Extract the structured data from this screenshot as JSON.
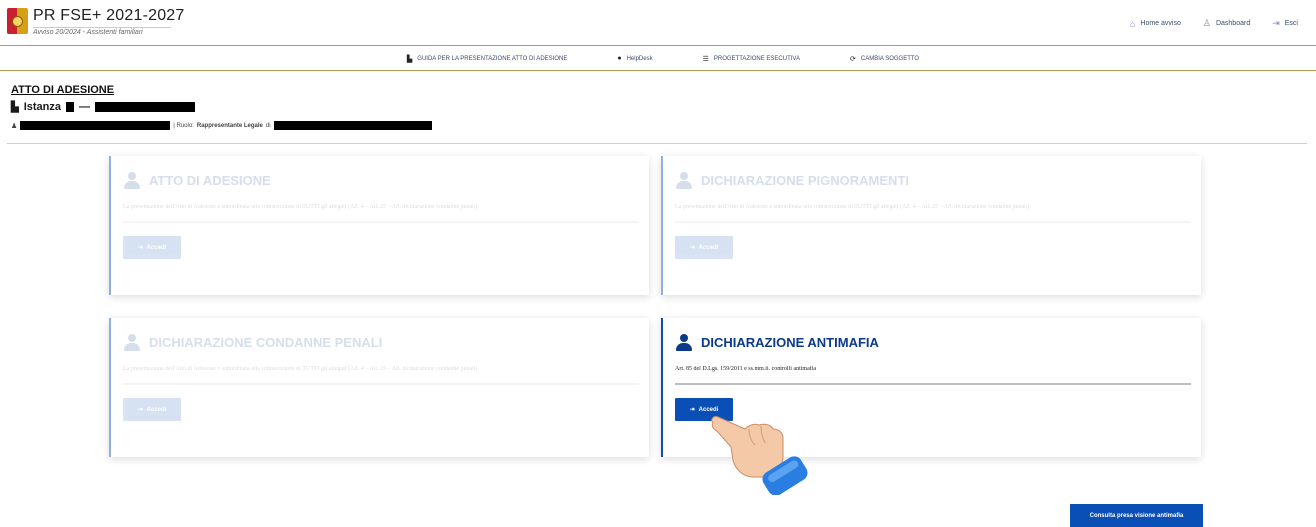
{
  "header": {
    "title": "PR FSE+ 2021-2027",
    "subtitle": "Avviso 20/2024 - Assistenti familiari",
    "nav": [
      {
        "label": "Home avviso",
        "icon": "home-icon"
      },
      {
        "label": "Dashboard",
        "icon": "user-icon"
      },
      {
        "label": "Esci",
        "icon": "logout-icon"
      }
    ]
  },
  "subnav": [
    {
      "label": "GUIDA PER LA PRESENTAZIONE ATTO DI ADESIONE",
      "icon": "file-icon"
    },
    {
      "label": "HelpDesk",
      "icon": "help-icon"
    },
    {
      "label": "PROGETTAZIONE ESECUTIVA",
      "icon": "list-icon"
    },
    {
      "label": "CAMBIA SOGGETTO",
      "icon": "refresh-icon"
    }
  ],
  "page": {
    "title": "ATTO DI ADESIONE",
    "istanza_label": "Istanza",
    "istanza_sep": "—",
    "ruolo_text": "| Ruolo:",
    "ruolo_value": "Rappresentante Legale",
    "ruolo_di": "di"
  },
  "cards": [
    {
      "title": "ATTO DI ADESIONE",
      "desc": "La presentazione dell'Atto di Adesione è subordinata alla sottoscrizione di TUTTI gli allegati (All. 4 – All. 25 – All. dichiarazione condanne penali)",
      "button": "Accedi",
      "enabled": false
    },
    {
      "title": "DICHIARAZIONE PIGNORAMENTI",
      "desc": "La presentazione dell'Atto di Adesione è subordinata alla sottoscrizione di TUTTI gli allegati (All. 4 – All. 25 – All. dichiarazione condanne penali)",
      "button": "Accedi",
      "enabled": false
    },
    {
      "title": "DICHIARAZIONE CONDANNE PENALI",
      "desc": "La presentazione dell'Atto di Adesione è subordinata alla sottoscrizione di TUTTI gli allegati (All. 4 – All. 25 – All. dichiarazione condanne penali)",
      "button": "Accedi",
      "enabled": false
    },
    {
      "title": "DICHIARAZIONE ANTIMAFIA",
      "desc": "Art. 85 del D.Lgs. 159/2011 e ss.mm.ii. controlli antimafia",
      "button": "Accedi",
      "enabled": true
    }
  ],
  "consulta_button": "Consulta presa visione antimafia",
  "colors": {
    "primary": "#0a4fb5",
    "heading": "#0b3a8a",
    "gold_rule": "#b79a55"
  }
}
